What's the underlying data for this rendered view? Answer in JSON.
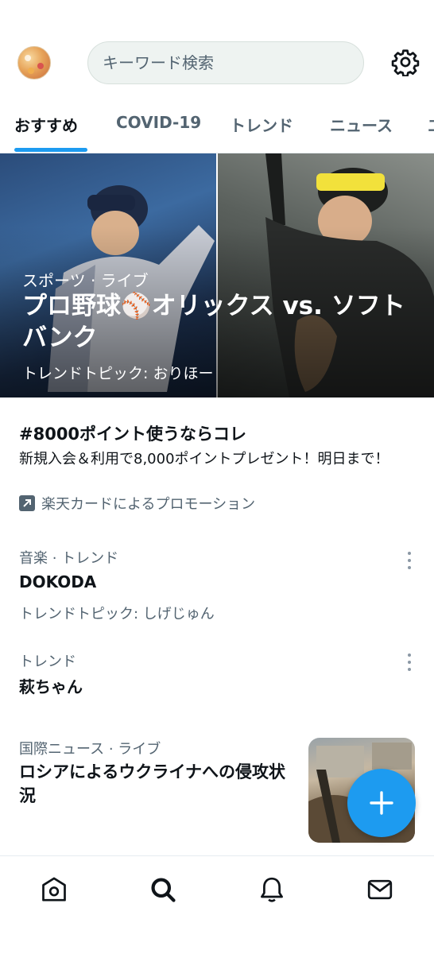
{
  "header": {
    "search_placeholder": "キーワード検索"
  },
  "tabs": [
    {
      "label": "おすすめ",
      "active": true
    },
    {
      "label": "COVID-19",
      "active": false
    },
    {
      "label": "トレンド",
      "active": false
    },
    {
      "label": "ニュース",
      "active": false
    },
    {
      "label": "エ",
      "active": false
    }
  ],
  "hero": {
    "category": "スポーツ · ライブ",
    "title": "プロ野球⚾オリックス vs. ソフトバンク",
    "subtitle": "トレンドトピック: おりほー"
  },
  "promo": {
    "title": "#8000ポイント使うならコレ",
    "description": "新規入会＆利用で8,000ポイントプレゼント！明日まで！",
    "promoted_by": "楽天カードによるプロモーション"
  },
  "trends": [
    {
      "category": "音楽 · トレンド",
      "title": "DOKODA",
      "topic": "トレンドトピック: しげじゅん"
    },
    {
      "category": "トレンド",
      "title": "萩ちゃん"
    }
  ],
  "news": {
    "category": "国際ニュース · ライブ",
    "title": "ロシアによるウクライナへの侵攻状況"
  },
  "colors": {
    "accent": "#1d9bf0",
    "text": "#0f1419",
    "secondary": "#536471"
  },
  "bottom_nav": [
    "home-icon",
    "search-icon",
    "bell-icon",
    "mail-icon"
  ]
}
